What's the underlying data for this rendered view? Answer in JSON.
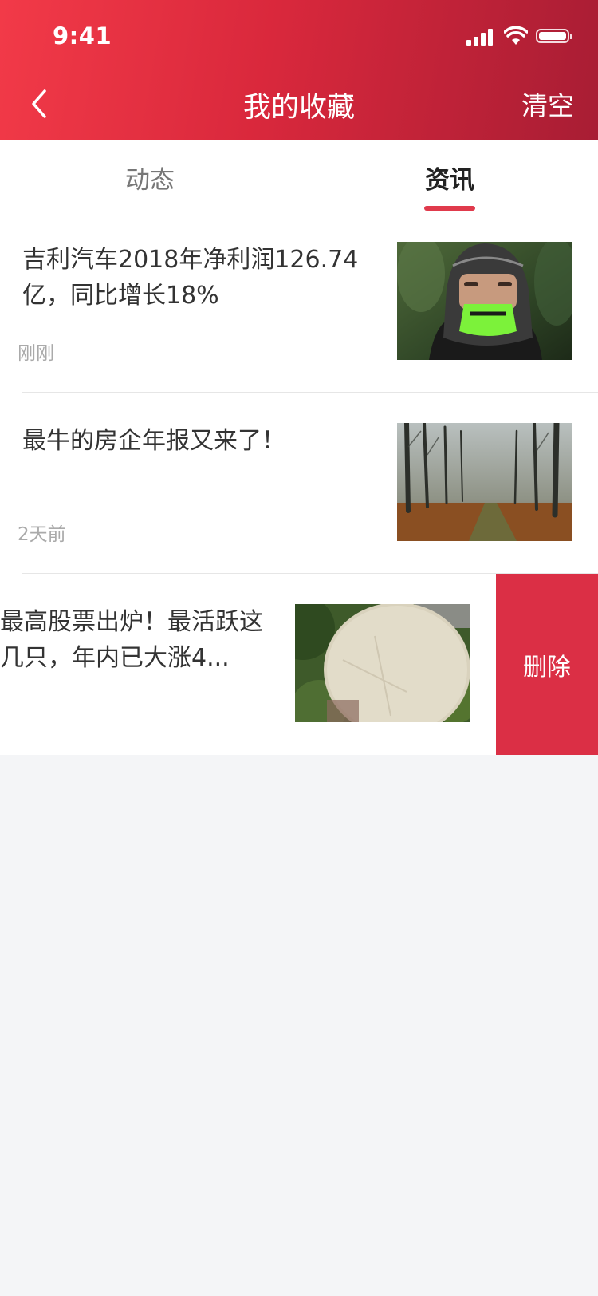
{
  "status_bar": {
    "time": "9:41"
  },
  "nav": {
    "title": "我的收藏",
    "right_action": "清空"
  },
  "tabs": [
    {
      "label": "动态"
    },
    {
      "label": "资讯"
    }
  ],
  "active_tab": "资讯",
  "articles": [
    {
      "title": "吉利汽车2018年净利润126.74亿，同比增长18%",
      "time": "刚刚"
    },
    {
      "title": "最牛的房企年报又来了！",
      "time": "2天前"
    },
    {
      "title": "最高股票出炉！最活跃这几只，年内已大涨4...",
      "time": ""
    }
  ],
  "swipe_action": {
    "label": "删除"
  },
  "colors": {
    "brand_red": "#e03a4c",
    "delete_red": "#db2f45"
  },
  "icons": {
    "back": "chevron-left-icon",
    "signal": "signal-icon",
    "wifi": "wifi-icon",
    "battery": "battery-icon"
  }
}
